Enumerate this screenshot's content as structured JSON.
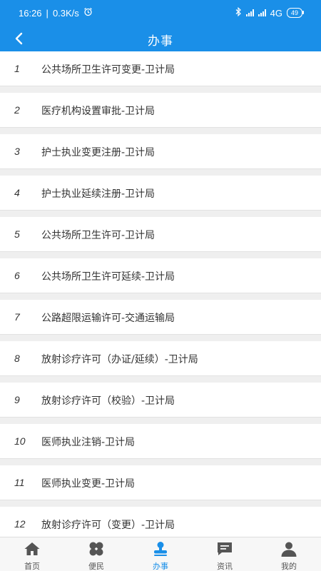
{
  "status": {
    "time": "16:26",
    "separator": "|",
    "speed": "0.3K/s",
    "network": "4G",
    "battery": "49"
  },
  "header": {
    "title": "办事"
  },
  "items": [
    {
      "index": "1",
      "name": "公共场所卫生许可变更-卫计局"
    },
    {
      "index": "2",
      "name": "医疗机构设置审批-卫计局"
    },
    {
      "index": "3",
      "name": "护士执业变更注册-卫计局"
    },
    {
      "index": "4",
      "name": "护士执业延续注册-卫计局"
    },
    {
      "index": "5",
      "name": "公共场所卫生许可-卫计局"
    },
    {
      "index": "6",
      "name": "公共场所卫生许可延续-卫计局"
    },
    {
      "index": "7",
      "name": "公路超限运输许可-交通运输局"
    },
    {
      "index": "8",
      "name": "放射诊疗许可（办证/延续）-卫计局"
    },
    {
      "index": "9",
      "name": "放射诊疗许可（校验）-卫计局"
    },
    {
      "index": "10",
      "name": "医师执业注销-卫计局"
    },
    {
      "index": "11",
      "name": "医师执业变更-卫计局"
    },
    {
      "index": "12",
      "name": "放射诊疗许可（变更）-卫计局"
    }
  ],
  "tabs": [
    {
      "label": "首页",
      "icon": "home-icon"
    },
    {
      "label": "便民",
      "icon": "clover-icon"
    },
    {
      "label": "办事",
      "icon": "stamp-icon",
      "active": true
    },
    {
      "label": "资讯",
      "icon": "message-icon"
    },
    {
      "label": "我的",
      "icon": "user-icon"
    }
  ],
  "colors": {
    "primary": "#1a8fe8",
    "text": "#333333",
    "tab_inactive": "#555555"
  }
}
